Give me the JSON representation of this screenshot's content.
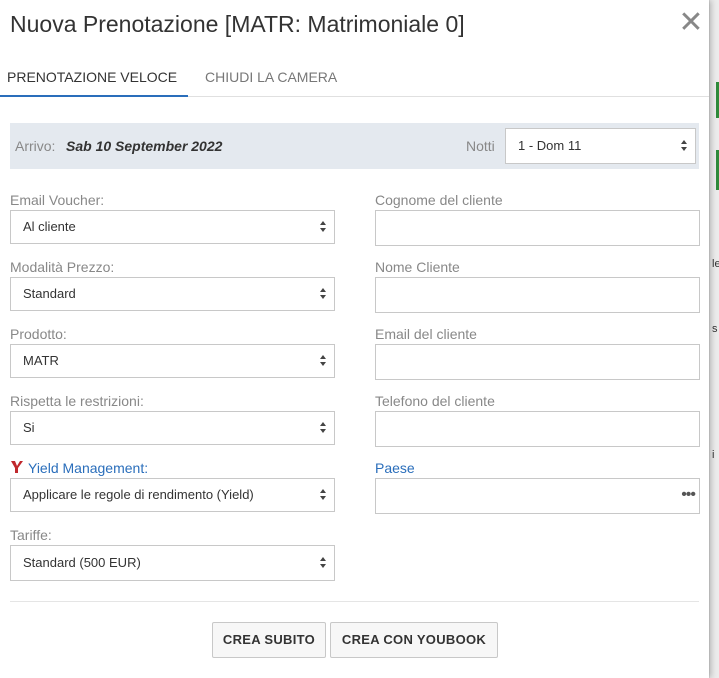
{
  "modal": {
    "title": "Nuova Prenotazione [MATR: Matrimoniale 0]",
    "close_glyph": "✕"
  },
  "tabs": [
    {
      "label": "PRENOTAZIONE VELOCE",
      "active": true
    },
    {
      "label": "CHIUDI LA CAMERA",
      "active": false
    }
  ],
  "arrival": {
    "label": "Arrivo:",
    "date": "Sab 10 September 2022",
    "nights_label": "Notti",
    "nights_value": "1 - Dom 11"
  },
  "left_fields": [
    {
      "label": "Email Voucher:",
      "value": "Al cliente"
    },
    {
      "label": "Modalità Prezzo:",
      "value": "Standard"
    },
    {
      "label": "Prodotto:",
      "value": "MATR"
    },
    {
      "label": "Rispetta le restrizioni:",
      "value": "Si"
    },
    {
      "label": "Yield Management:",
      "value": "Applicare le regole di rendimento (Yield)"
    },
    {
      "label": "Tariffe:",
      "value": "Standard (500 EUR)"
    }
  ],
  "right_fields": [
    {
      "label": "Cognome del cliente",
      "value": ""
    },
    {
      "label": "Nome Cliente",
      "value": ""
    },
    {
      "label": "Email del cliente",
      "value": ""
    },
    {
      "label": "Telefono del cliente",
      "value": ""
    },
    {
      "label": "Paese",
      "value": ""
    }
  ],
  "buttons": {
    "create_now": "CREA SUBITO",
    "create_youbook": "CREA CON YOUBOOK"
  },
  "colors": {
    "accent": "#2a6ebb",
    "yield_icon": "#c0282d",
    "bar_bg": "#e4e9ef"
  },
  "background_strip": [
    "le",
    "s",
    "i"
  ]
}
